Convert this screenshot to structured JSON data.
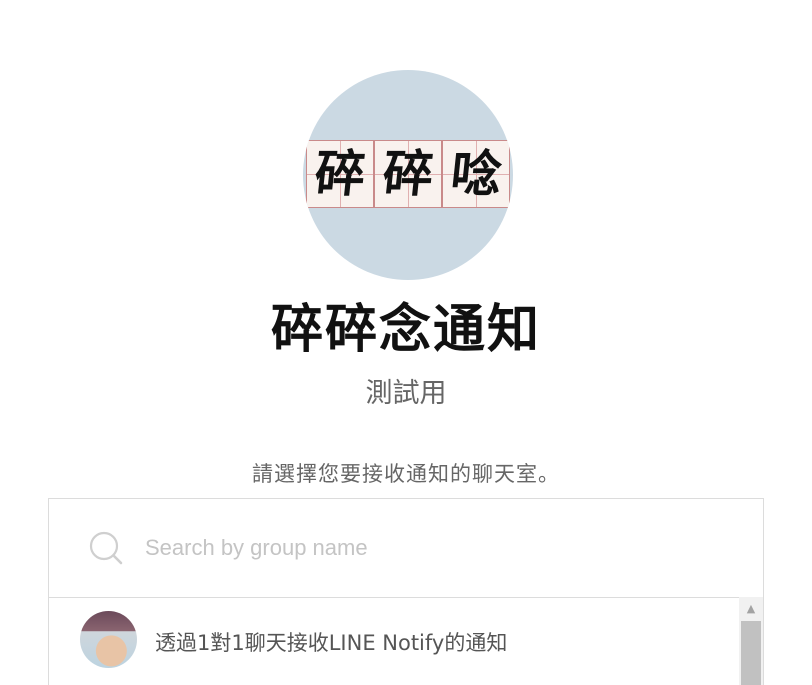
{
  "bot": {
    "logo_chars": [
      "碎",
      "碎",
      "唸"
    ],
    "name": "碎碎念通知",
    "description": "測試用"
  },
  "prompt": "請選擇您要接收通知的聊天室。",
  "search": {
    "placeholder": "Search by group name",
    "value": ""
  },
  "chat_list": [
    {
      "label": "透過1對1聊天接收LINE Notify的通知"
    }
  ],
  "colors": {
    "avatar_bg": "#cbd9e3",
    "text_primary": "#111111",
    "text_secondary": "#666666",
    "border": "#dcdcdc",
    "placeholder": "#c4c4c4"
  },
  "icons": {
    "search": "search-icon",
    "scroll_up": "scroll-up-arrow-icon"
  }
}
